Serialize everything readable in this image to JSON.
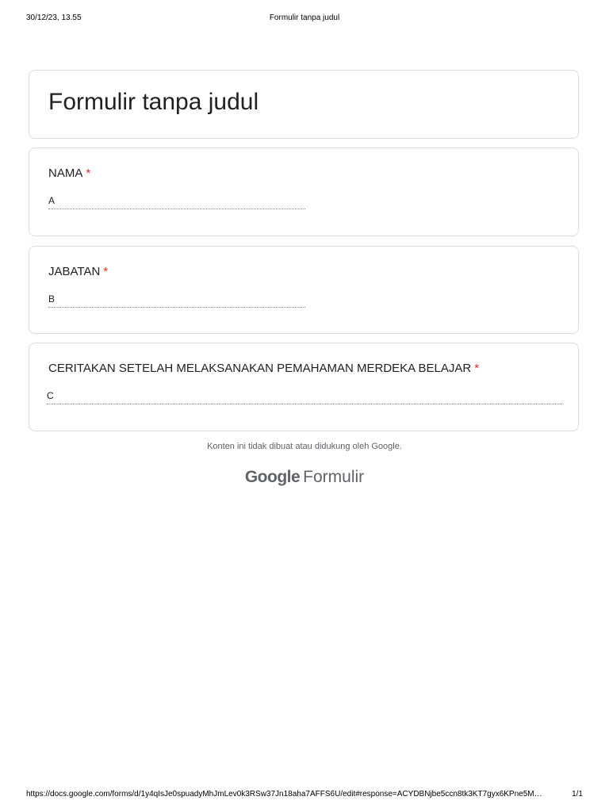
{
  "print_header": {
    "datetime": "30/12/23, 13.55",
    "page_title": "Formulir tanpa judul"
  },
  "form": {
    "title": "Formulir tanpa judul",
    "questions": [
      {
        "label": "NAMA",
        "required_mark": "*",
        "answer": "A"
      },
      {
        "label": "JABATAN",
        "required_mark": "*",
        "answer": "B"
      },
      {
        "label": "CERITAKAN SETELAH MELAKSANAKAN PEMAHAMAN MERDEKA BELAJAR",
        "required_mark": "*",
        "answer": "C"
      }
    ]
  },
  "footer": {
    "disclaimer": "Konten ini tidak dibuat atau didukung oleh Google.",
    "brand_google": "Google",
    "brand_product": "Formulir"
  },
  "print_footer": {
    "url": "https://docs.google.com/forms/d/1y4qIsJe0spuadyMhJmLev0k3RSw37Jn18aha7AFFS6U/edit#response=ACYDBNjbe5ccn8tk3KT7gyx6KPne5M…",
    "page": "1/1"
  },
  "colors": {
    "required": "#d93025",
    "card_border": "#dadce0",
    "muted_text": "#5f6368"
  }
}
